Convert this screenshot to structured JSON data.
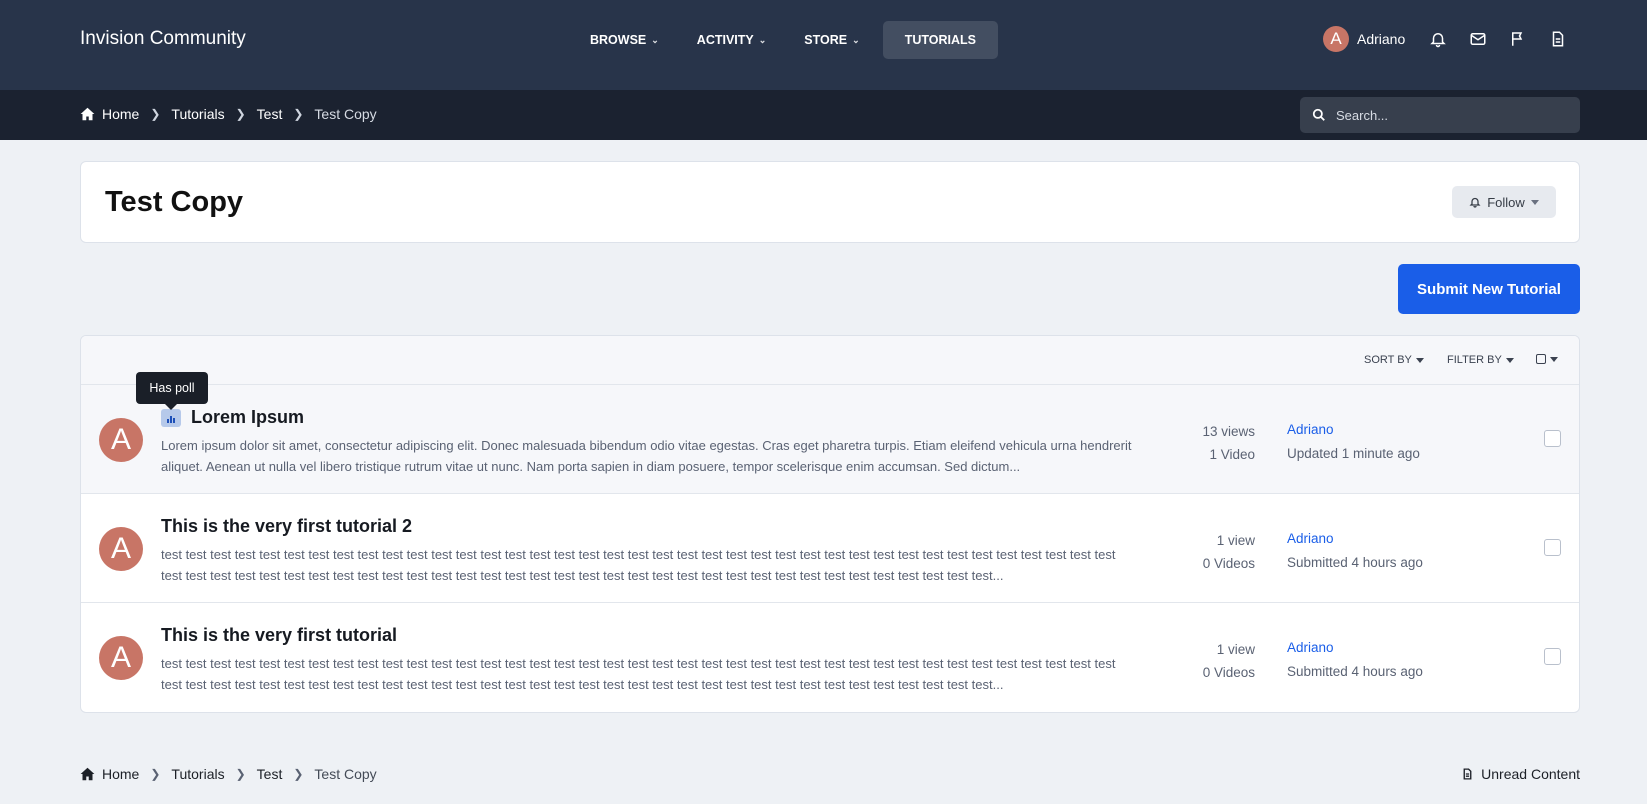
{
  "header": {
    "site_title": "Invision Community",
    "nav": [
      {
        "label": "BROWSE",
        "has_menu": true
      },
      {
        "label": "ACTIVITY",
        "has_menu": true
      },
      {
        "label": "STORE",
        "has_menu": true
      },
      {
        "label": "TUTORIALS",
        "has_menu": false,
        "active": true
      }
    ],
    "user": {
      "initial": "A",
      "name": "Adriano"
    },
    "icons": [
      "bell-icon",
      "envelope-icon",
      "flag-icon",
      "document-icon"
    ]
  },
  "breadcrumb": [
    "Home",
    "Tutorials",
    "Test",
    "Test Copy"
  ],
  "search": {
    "placeholder": "Search..."
  },
  "page": {
    "title": "Test Copy",
    "follow_label": "Follow",
    "submit_label": "Submit New Tutorial"
  },
  "toolbar": {
    "sort_label": "SORT BY",
    "filter_label": "FILTER BY"
  },
  "tooltip": "Has poll",
  "rows": [
    {
      "initial": "A",
      "title": "Lorem Ipsum",
      "has_poll": true,
      "description": "Lorem ipsum dolor sit amet, consectetur adipiscing elit. Donec malesuada bibendum odio vitae egestas. Cras eget pharetra turpis. Etiam eleifend vehicula urna hendrerit aliquet. Aenean ut nulla vel libero tristique rutrum vitae ut nunc. Nam porta sapien in diam posuere, tempor scelerisque enim accumsan. Sed dictum...",
      "views": "13 views",
      "videos": "1 Video",
      "author": "Adriano",
      "status": "Updated 1 minute ago"
    },
    {
      "initial": "A",
      "title": "This is the very first tutorial 2",
      "has_poll": false,
      "description": "test test test test test test test test test test test test test test test test test test test test test test test test test test test test test test test test test test test test test test test test test test test test test test test test test test test test test test test test test test test test test test test test test test test test test test test test test...",
      "views": "1 view",
      "videos": "0 Videos",
      "author": "Adriano",
      "status": "Submitted 4 hours ago"
    },
    {
      "initial": "A",
      "title": "This is the very first tutorial",
      "has_poll": false,
      "description": "test test test test test test test test test test test test test test test test test test test test test test test test test test test test test test test test test test test test test test test test test test test test test test test test test test test test test test test test test test test test test test test test test test test test test test test test test...",
      "views": "1 view",
      "videos": "0 Videos",
      "author": "Adriano",
      "status": "Submitted 4 hours ago"
    }
  ],
  "footer": {
    "unread_label": "Unread Content"
  },
  "colors": {
    "header": "#28344a",
    "crumbbar": "#1b2230",
    "accent": "#1a5ee8",
    "avatar": "#c87566"
  }
}
